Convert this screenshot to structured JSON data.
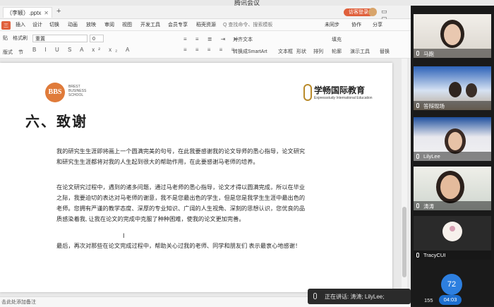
{
  "window": {
    "title": "腾讯会议"
  },
  "ppt": {
    "tab_label": "（李颖）.pptx",
    "login_label": "访客登录",
    "menu": [
      "三",
      "插入",
      "设计",
      "切换",
      "动画",
      "放映",
      "审阅",
      "视图",
      "开发工具",
      "会员专享",
      "稻壳资源"
    ],
    "menu_search": "Q 查找命令、搜索模板",
    "menu_right": [
      "未同步",
      "协作",
      "分享"
    ],
    "toolbar": {
      "paste_label": "贴",
      "format_painter_label": "格式刷",
      "layout_label": "版式",
      "section_label": "节",
      "font_name": "重置",
      "font_size": "0",
      "right_group_1": "对齐文本",
      "right_group_2": "转换成SmartArt",
      "textbox_label": "文本框",
      "shape_label": "形状",
      "arrange_label": "排列",
      "fill_label": "填充",
      "outline_label": "轮廓",
      "presenter_tools_label": "演示工具",
      "replace_label": "替换"
    },
    "slide": {
      "logo_left_mark": "BBS",
      "logo_left_text": "BREST BUSINESS SCHOOL",
      "logo_right_name": "学畅国际教育",
      "logo_right_sub": "Expressstudy International Education",
      "heading": "六、致谢",
      "paragraph1": [
        "我的研究生生涯即将画上一个圆满完美的句号，在此我要感谢我的论文导师的悉心指导，论文研究",
        "和研究生生涯都将对我的人生起到很大的帮助作用，在此要感谢马老师的培养。"
      ],
      "paragraph2": [
        "在论文研究过程中，遇到的诸多问题，通过马老师的悉心指导，论文才得以圆满完成，所以在毕业",
        "之际，我要迫切的表达对马老师的谢意，我不是您最出色的学生，但是您是我学生生涯中最出色的",
        "老师。您拥有严谨的教学态度、深厚的专业知识、广阔的人生视角、深刻的思想认识，您优良的品",
        "质感染着我, 让我在论文的完成中克服了种种困难，使我的论文更加完善。"
      ],
      "paragraph3": [
        "最后，再次对那些在论文完成过程中，帮助关心过我的老师、同学和朋友们 表示最衷心地感谢！"
      ]
    },
    "status_note": "击此处添加备注"
  },
  "meeting": {
    "speaking_label": "正在讲话: 涛涛; LilyLee;",
    "participants": [
      {
        "name": "马跑"
      },
      {
        "name": "答辩现场"
      },
      {
        "name": "LilyLee"
      },
      {
        "name": "涛涛"
      },
      {
        "name": "TracyCUI"
      }
    ],
    "participant_count": "72",
    "timer": "04:03",
    "partial_count": "155"
  },
  "colors": {
    "accent": "#e0603c",
    "meeting_blue": "#2d7fe0"
  }
}
